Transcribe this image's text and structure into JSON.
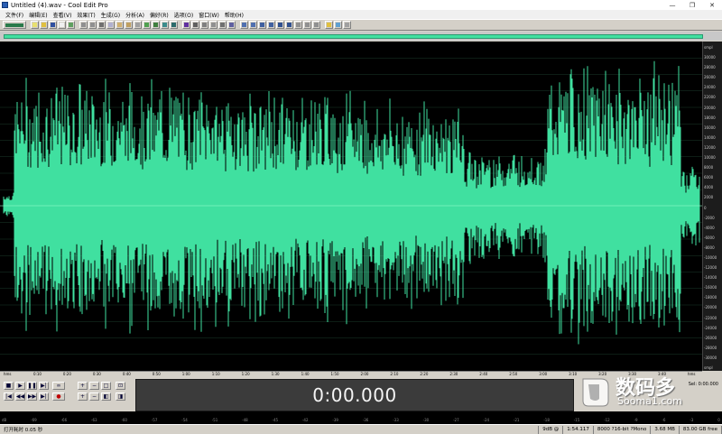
{
  "window": {
    "title": "Untitled (4).wav - Cool Edit Pro",
    "min_glyph": "—",
    "max_glyph": "❐",
    "close_glyph": "✕"
  },
  "menu": [
    "文件(F)",
    "编辑(E)",
    "查看(V)",
    "效果(T)",
    "生成(G)",
    "分析(A)",
    "偏好(R)",
    "选项(O)",
    "窗口(W)",
    "帮助(H)"
  ],
  "waveform": {
    "color": "#40e0a0",
    "background": "#000000",
    "amplitude_ticks": [
      "smpl",
      "30000",
      "28000",
      "26000",
      "24000",
      "22000",
      "20000",
      "18000",
      "16000",
      "14000",
      "12000",
      "10000",
      "8000",
      "6000",
      "4000",
      "2000",
      "0",
      "-2000",
      "-4000",
      "-6000",
      "-8000",
      "-10000",
      "-12000",
      "-14000",
      "-16000",
      "-18000",
      "-20000",
      "-22000",
      "-24000",
      "-26000",
      "-28000",
      "-30000",
      "smpl"
    ]
  },
  "time_ruler": [
    "hms",
    "0:10",
    "0:20",
    "0:30",
    "0:40",
    "0:50",
    "1:00",
    "1:10",
    "1:20",
    "1:30",
    "1:40",
    "1:50",
    "2:00",
    "2:10",
    "2:20",
    "2:30",
    "2:40",
    "2:50",
    "3:00",
    "3:10",
    "3:20",
    "3:30",
    "3:40",
    "hms"
  ],
  "transport": {
    "stop": "■",
    "play": "▶",
    "pause": "❚❚",
    "play_to_end": "▶|",
    "loop": "∞",
    "go_start": "|◀",
    "rewind": "◀◀",
    "fast_forward": "▶▶",
    "go_end": "▶|",
    "record": "●",
    "zoom_in_h": "+",
    "zoom_out_h": "−",
    "zoom_full": "□",
    "zoom_sel": "⊡",
    "zoom_in_v": "+",
    "zoom_out_v": "−",
    "zoom_left": "◧",
    "zoom_right": "◨"
  },
  "time_display": "0:00.000",
  "selection_readout": "Sel: 0:00.000",
  "level_meter": [
    "dB",
    "-69",
    "-66",
    "-63",
    "-60",
    "-57",
    "-54",
    "-51",
    "-48",
    "-45",
    "-42",
    "-39",
    "-36",
    "-33",
    "-30",
    "-27",
    "-24",
    "-21",
    "-18",
    "-15",
    "-12",
    "-9",
    "-6",
    "-3",
    "0"
  ],
  "status": {
    "left": "打开耗时 0.05 秒",
    "view": "9dB @",
    "time": "1:54.117",
    "format": "8000 ?16-bit ?Mono",
    "size": "3.68 MB",
    "free": "83.00 GB free"
  },
  "watermark": {
    "title": "数码多",
    "sub": "Sooma1.com"
  }
}
